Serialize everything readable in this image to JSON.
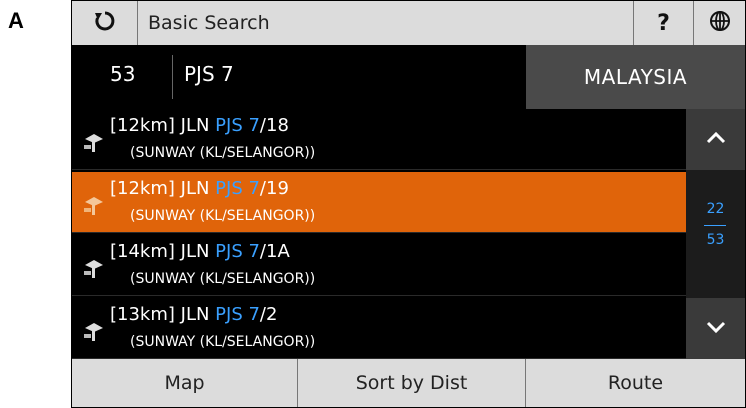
{
  "panel_label": "A",
  "toolbar": {
    "title": "Basic Search",
    "help_label": "?",
    "icons": {
      "refresh": "refresh-icon",
      "globe": "globe-icon"
    }
  },
  "search": {
    "result_count": "53",
    "query": "PJS 7",
    "country": "MALAYSIA"
  },
  "results": [
    {
      "prefix": "[12km] JLN ",
      "match": "PJS 7",
      "suffix": "/18",
      "area": "(SUNWAY (KL/SELANGOR))",
      "selected": false
    },
    {
      "prefix": "[12km] JLN ",
      "match": "PJS 7",
      "suffix": "/19",
      "area": "(SUNWAY (KL/SELANGOR))",
      "selected": true
    },
    {
      "prefix": "[14km] JLN ",
      "match": "PJS 7",
      "suffix": "/1A",
      "area": "(SUNWAY (KL/SELANGOR))",
      "selected": false
    },
    {
      "prefix": "[13km] JLN ",
      "match": "PJS 7",
      "suffix": "/2",
      "area": "(SUNWAY (KL/SELANGOR))",
      "selected": false
    }
  ],
  "pager": {
    "current": "22",
    "total": "53"
  },
  "bottom": {
    "map": "Map",
    "sort": "Sort by Dist",
    "route": "Route"
  },
  "colors": {
    "selected": "#e0640a",
    "highlight": "#3aa0ff",
    "bar": "#dcdcdc"
  }
}
